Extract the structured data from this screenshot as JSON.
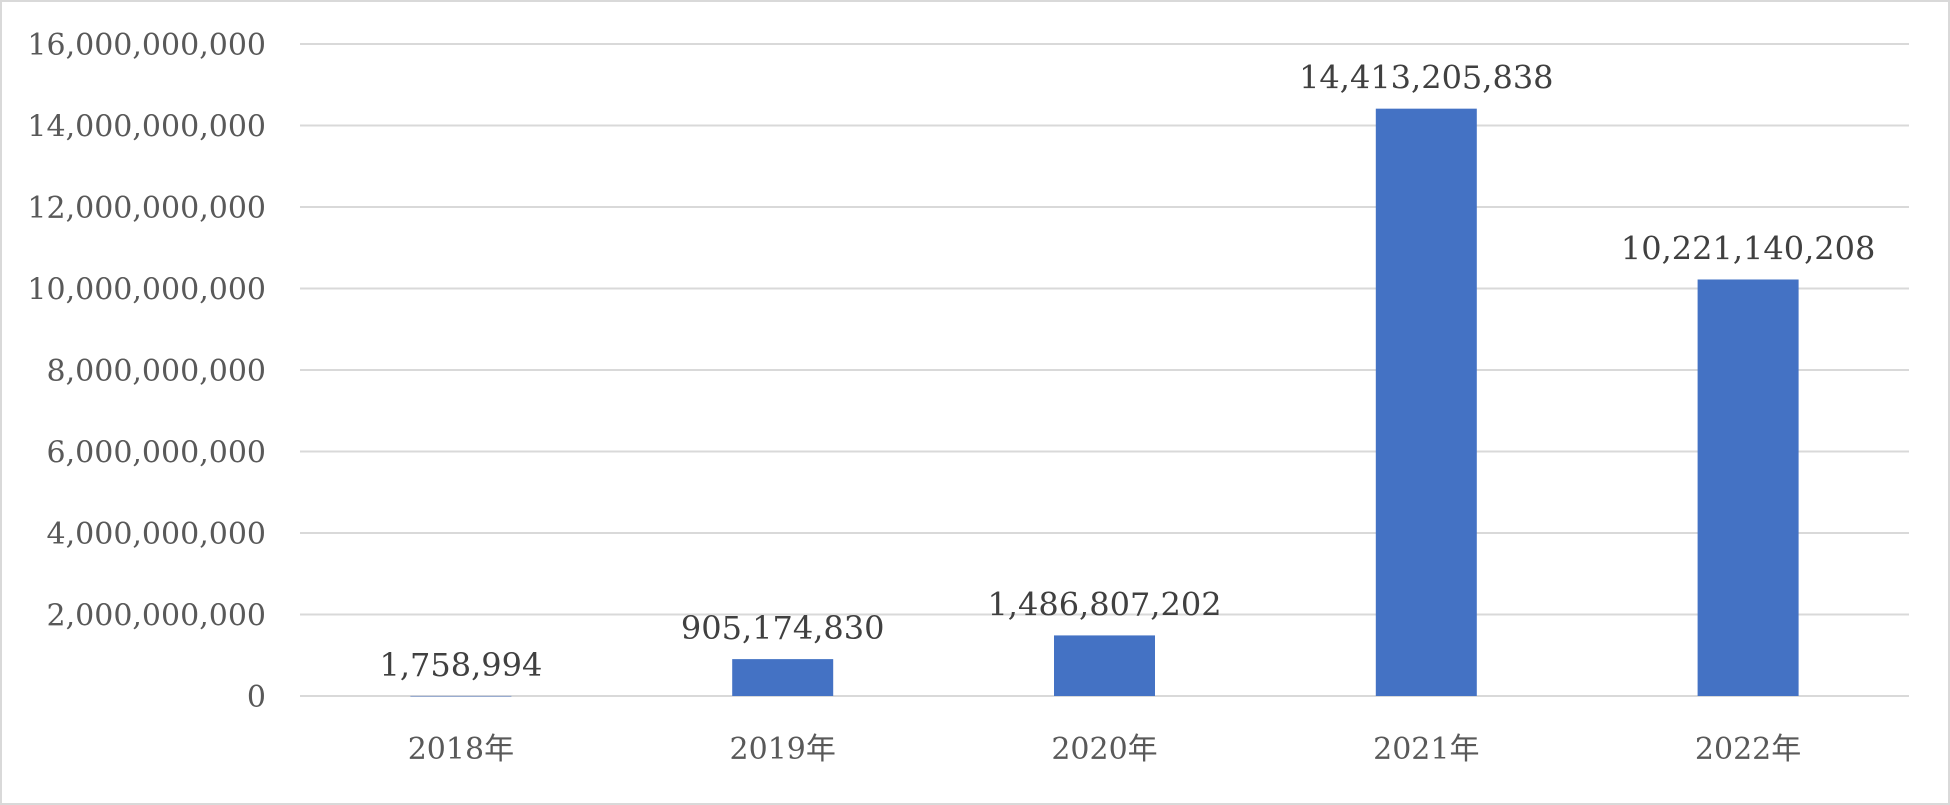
{
  "chart_data": {
    "type": "bar",
    "categories": [
      "2018年",
      "2019年",
      "2020年",
      "2021年",
      "2022年"
    ],
    "values": [
      1758994,
      905174830,
      1486807202,
      14413205838,
      10221140208
    ],
    "data_labels": [
      "1,758,994",
      "905,174,830",
      "1,486,807,202",
      "14,413,205,838",
      "10,221,140,208"
    ],
    "y_ticks": [
      0,
      2000000000,
      4000000000,
      6000000000,
      8000000000,
      10000000000,
      12000000000,
      14000000000,
      16000000000
    ],
    "y_tick_labels": [
      "0",
      "2,000,000,000",
      "4,000,000,000",
      "6,000,000,000",
      "8,000,000,000",
      "10,000,000,000",
      "12,000,000,000",
      "14,000,000,000",
      "16,000,000,000"
    ],
    "ylim": [
      0,
      16000000000
    ],
    "grid": true,
    "legend": "none",
    "title": "",
    "xlabel": "",
    "ylabel": "",
    "colors": {
      "bar": "#4472C4",
      "grid": "#d9d9d9",
      "text": "#595959"
    }
  }
}
